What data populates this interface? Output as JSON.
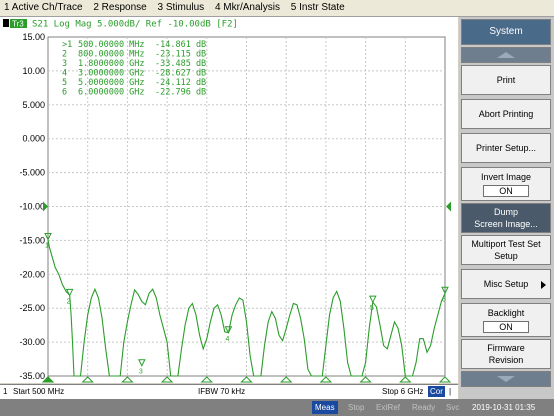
{
  "menu": [
    "1 Active Ch/Trace",
    "2 Response",
    "3 Stimulus",
    "4 Mkr/Analysis",
    "5 Instr State"
  ],
  "trace_header": {
    "trace_id": "Tr3",
    "text": "S21 Log Mag 5.000dB/ Ref -10.00dB [F2]"
  },
  "markers": [
    {
      "id": ">1",
      "freq": "500.00000 MHz",
      "value": "-14.861 dB"
    },
    {
      "id": "2",
      "freq": "800.00000 MHz",
      "value": "-23.115 dB"
    },
    {
      "id": "3",
      "freq": "1.8000000 GHz",
      "value": "-33.485 dB"
    },
    {
      "id": "4",
      "freq": "3.0000000 GHz",
      "value": "-28.627 dB"
    },
    {
      "id": "5",
      "freq": "5.0000000 GHz",
      "value": "-24.112 dB"
    },
    {
      "id": "6",
      "freq": "6.0000000 GHz",
      "value": "-22.796 dB"
    }
  ],
  "status": {
    "channel": "1",
    "start": "Start 500 MHz",
    "ifbw": "IFBW 70 kHz",
    "stop": "Stop 6 GHz",
    "cor": "Cor"
  },
  "footer": {
    "items": [
      "Meas",
      "Stop",
      "ExtRef",
      "Ready",
      "Svc"
    ],
    "datetime": "2019-10-31 01:35"
  },
  "softkeys": {
    "title": "System",
    "print": "Print",
    "abort": "Abort Printing",
    "printer_setup": "Printer Setup...",
    "invert_label": "Invert Image",
    "invert_value": "ON",
    "dump": "Dump\nScreen Image...",
    "multiport": "Multiport Test Set\nSetup",
    "misc": "Misc Setup",
    "backlight_label": "Backlight",
    "backlight_value": "ON",
    "firmware": "Firmware\nRevision"
  },
  "colors": {
    "trace": "#2a9d2a",
    "grid": "#c8c8c8",
    "axis_text": "#000000"
  },
  "chart_data": {
    "type": "line",
    "ylim": [
      -35,
      15
    ],
    "xlim": [
      0.5,
      6
    ],
    "x_unit": "GHz",
    "y_ticks": [
      "15.00",
      "10.00",
      "5.000",
      "0.000",
      "-5.000",
      "-10.00",
      "-15.00",
      "-20.00",
      "-25.00",
      "-30.00",
      "-35.00"
    ],
    "reference_level": -10,
    "series": [
      {
        "x": [
          0.5,
          0.52,
          0.56,
          0.6,
          0.65,
          0.7,
          0.75,
          0.8,
          0.82,
          0.84,
          0.86,
          0.88,
          0.92,
          0.95,
          1.0,
          1.05,
          1.1,
          1.15,
          1.2,
          1.25,
          1.3,
          1.35,
          1.4,
          1.45,
          1.5,
          1.55,
          1.6,
          1.65,
          1.7,
          1.75,
          1.8,
          1.85,
          1.9,
          1.95,
          2.0,
          2.05,
          2.1,
          2.15,
          2.2,
          2.25,
          2.3,
          2.35,
          2.4,
          2.45,
          2.5,
          2.55,
          2.6,
          2.65,
          2.7,
          2.75,
          2.8,
          2.85,
          2.9,
          2.95,
          3.0,
          3.05,
          3.1,
          3.15,
          3.2,
          3.25,
          3.3,
          3.35,
          3.4,
          3.45,
          3.5,
          3.55,
          3.6,
          3.65,
          3.7,
          3.75,
          3.8,
          3.85,
          3.9,
          3.95,
          4.0,
          4.05,
          4.1,
          4.15,
          4.2,
          4.25,
          4.3,
          4.35,
          4.4,
          4.45,
          4.5,
          4.55,
          4.6,
          4.65,
          4.7,
          4.75,
          4.8,
          4.85,
          4.9,
          4.95,
          5.0,
          5.05,
          5.1,
          5.15,
          5.2,
          5.25,
          5.3,
          5.35,
          5.4,
          5.45,
          5.5,
          5.55,
          5.6,
          5.65,
          5.7,
          5.75,
          5.8,
          5.85,
          5.9,
          5.95,
          6.0
        ],
        "y": [
          -14.9,
          -16,
          -17.5,
          -19,
          -20,
          -21.5,
          -22.5,
          -23.1,
          -26,
          -30,
          -35,
          -35,
          -35,
          -35,
          -30,
          -26,
          -23.5,
          -22.2,
          -23.5,
          -26.5,
          -31,
          -35,
          -35,
          -35,
          -35,
          -30,
          -27,
          -24.5,
          -22.3,
          -23,
          -24,
          -24.5,
          -22.8,
          -22.2,
          -23.5,
          -26,
          -28,
          -30,
          -35,
          -35,
          -35,
          -31,
          -27.5,
          -25,
          -24.3,
          -26,
          -29,
          -31,
          -29.5,
          -27,
          -25,
          -24.5,
          -26,
          -28.5,
          -28.6,
          -26,
          -24.5,
          -23.5,
          -23.8,
          -27,
          -32,
          -35,
          -35,
          -35,
          -30.5,
          -27,
          -25.5,
          -26.5,
          -29,
          -29.8,
          -28,
          -26,
          -24.3,
          -24.5,
          -26.5,
          -29.5,
          -34,
          -35,
          -35,
          -35,
          -35,
          -30.5,
          -26,
          -23.5,
          -22.5,
          -24,
          -28,
          -33,
          -35,
          -35,
          -35,
          -35,
          -33,
          -28,
          -24.1,
          -24.8,
          -27.5,
          -30.5,
          -31,
          -29,
          -27,
          -28,
          -30.5,
          -35,
          -35,
          -35,
          -33,
          -29.5,
          -29.5,
          -31.5,
          -30.5,
          -28,
          -26,
          -24,
          -22.8
        ]
      }
    ]
  }
}
